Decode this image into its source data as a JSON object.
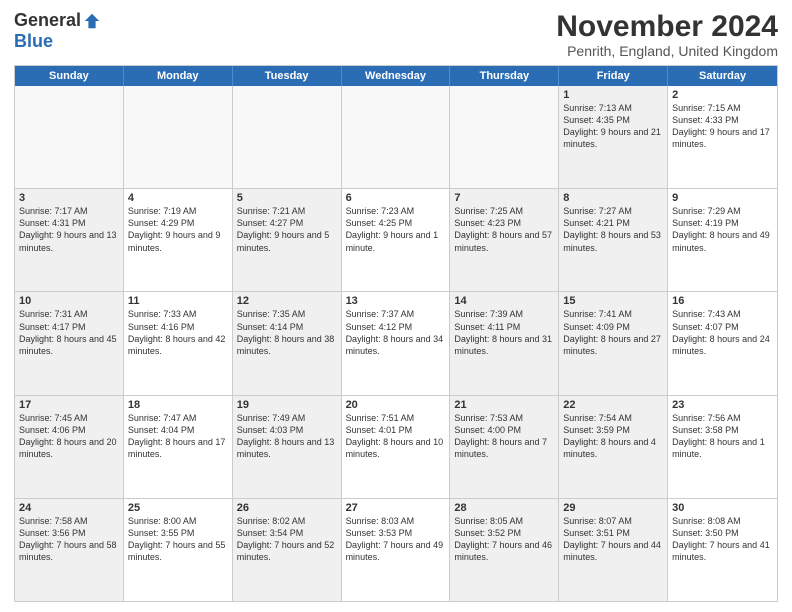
{
  "logo": {
    "general": "General",
    "blue": "Blue"
  },
  "title": "November 2024",
  "location": "Penrith, England, United Kingdom",
  "days": [
    "Sunday",
    "Monday",
    "Tuesday",
    "Wednesday",
    "Thursday",
    "Friday",
    "Saturday"
  ],
  "rows": [
    [
      {
        "day": "",
        "text": "",
        "empty": true
      },
      {
        "day": "",
        "text": "",
        "empty": true
      },
      {
        "day": "",
        "text": "",
        "empty": true
      },
      {
        "day": "",
        "text": "",
        "empty": true
      },
      {
        "day": "",
        "text": "",
        "empty": true
      },
      {
        "day": "1",
        "text": "Sunrise: 7:13 AM\nSunset: 4:35 PM\nDaylight: 9 hours and 21 minutes.",
        "shaded": true
      },
      {
        "day": "2",
        "text": "Sunrise: 7:15 AM\nSunset: 4:33 PM\nDaylight: 9 hours and 17 minutes.",
        "shaded": false
      }
    ],
    [
      {
        "day": "3",
        "text": "Sunrise: 7:17 AM\nSunset: 4:31 PM\nDaylight: 9 hours and 13 minutes.",
        "shaded": true
      },
      {
        "day": "4",
        "text": "Sunrise: 7:19 AM\nSunset: 4:29 PM\nDaylight: 9 hours and 9 minutes.",
        "shaded": false
      },
      {
        "day": "5",
        "text": "Sunrise: 7:21 AM\nSunset: 4:27 PM\nDaylight: 9 hours and 5 minutes.",
        "shaded": true
      },
      {
        "day": "6",
        "text": "Sunrise: 7:23 AM\nSunset: 4:25 PM\nDaylight: 9 hours and 1 minute.",
        "shaded": false
      },
      {
        "day": "7",
        "text": "Sunrise: 7:25 AM\nSunset: 4:23 PM\nDaylight: 8 hours and 57 minutes.",
        "shaded": true
      },
      {
        "day": "8",
        "text": "Sunrise: 7:27 AM\nSunset: 4:21 PM\nDaylight: 8 hours and 53 minutes.",
        "shaded": true
      },
      {
        "day": "9",
        "text": "Sunrise: 7:29 AM\nSunset: 4:19 PM\nDaylight: 8 hours and 49 minutes.",
        "shaded": false
      }
    ],
    [
      {
        "day": "10",
        "text": "Sunrise: 7:31 AM\nSunset: 4:17 PM\nDaylight: 8 hours and 45 minutes.",
        "shaded": true
      },
      {
        "day": "11",
        "text": "Sunrise: 7:33 AM\nSunset: 4:16 PM\nDaylight: 8 hours and 42 minutes.",
        "shaded": false
      },
      {
        "day": "12",
        "text": "Sunrise: 7:35 AM\nSunset: 4:14 PM\nDaylight: 8 hours and 38 minutes.",
        "shaded": true
      },
      {
        "day": "13",
        "text": "Sunrise: 7:37 AM\nSunset: 4:12 PM\nDaylight: 8 hours and 34 minutes.",
        "shaded": false
      },
      {
        "day": "14",
        "text": "Sunrise: 7:39 AM\nSunset: 4:11 PM\nDaylight: 8 hours and 31 minutes.",
        "shaded": true
      },
      {
        "day": "15",
        "text": "Sunrise: 7:41 AM\nSunset: 4:09 PM\nDaylight: 8 hours and 27 minutes.",
        "shaded": true
      },
      {
        "day": "16",
        "text": "Sunrise: 7:43 AM\nSunset: 4:07 PM\nDaylight: 8 hours and 24 minutes.",
        "shaded": false
      }
    ],
    [
      {
        "day": "17",
        "text": "Sunrise: 7:45 AM\nSunset: 4:06 PM\nDaylight: 8 hours and 20 minutes.",
        "shaded": true
      },
      {
        "day": "18",
        "text": "Sunrise: 7:47 AM\nSunset: 4:04 PM\nDaylight: 8 hours and 17 minutes.",
        "shaded": false
      },
      {
        "day": "19",
        "text": "Sunrise: 7:49 AM\nSunset: 4:03 PM\nDaylight: 8 hours and 13 minutes.",
        "shaded": true
      },
      {
        "day": "20",
        "text": "Sunrise: 7:51 AM\nSunset: 4:01 PM\nDaylight: 8 hours and 10 minutes.",
        "shaded": false
      },
      {
        "day": "21",
        "text": "Sunrise: 7:53 AM\nSunset: 4:00 PM\nDaylight: 8 hours and 7 minutes.",
        "shaded": true
      },
      {
        "day": "22",
        "text": "Sunrise: 7:54 AM\nSunset: 3:59 PM\nDaylight: 8 hours and 4 minutes.",
        "shaded": true
      },
      {
        "day": "23",
        "text": "Sunrise: 7:56 AM\nSunset: 3:58 PM\nDaylight: 8 hours and 1 minute.",
        "shaded": false
      }
    ],
    [
      {
        "day": "24",
        "text": "Sunrise: 7:58 AM\nSunset: 3:56 PM\nDaylight: 7 hours and 58 minutes.",
        "shaded": true
      },
      {
        "day": "25",
        "text": "Sunrise: 8:00 AM\nSunset: 3:55 PM\nDaylight: 7 hours and 55 minutes.",
        "shaded": false
      },
      {
        "day": "26",
        "text": "Sunrise: 8:02 AM\nSunset: 3:54 PM\nDaylight: 7 hours and 52 minutes.",
        "shaded": true
      },
      {
        "day": "27",
        "text": "Sunrise: 8:03 AM\nSunset: 3:53 PM\nDaylight: 7 hours and 49 minutes.",
        "shaded": false
      },
      {
        "day": "28",
        "text": "Sunrise: 8:05 AM\nSunset: 3:52 PM\nDaylight: 7 hours and 46 minutes.",
        "shaded": true
      },
      {
        "day": "29",
        "text": "Sunrise: 8:07 AM\nSunset: 3:51 PM\nDaylight: 7 hours and 44 minutes.",
        "shaded": true
      },
      {
        "day": "30",
        "text": "Sunrise: 8:08 AM\nSunset: 3:50 PM\nDaylight: 7 hours and 41 minutes.",
        "shaded": false
      }
    ]
  ]
}
